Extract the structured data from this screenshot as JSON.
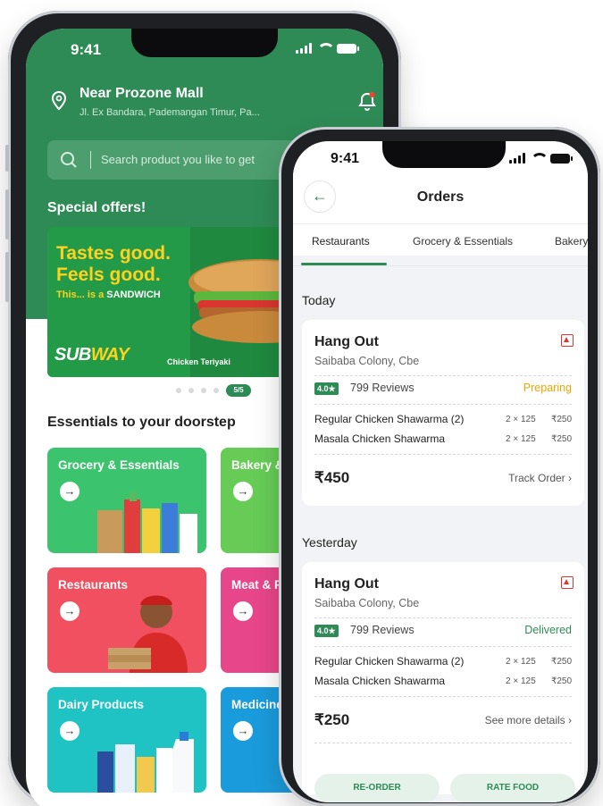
{
  "colors": {
    "brand_green": "#2e8b55",
    "preparing": "#f0a500",
    "delivered": "#2e8b55",
    "banner_yellow": "#ffd21f"
  },
  "phone1": {
    "status": {
      "time": "9:41"
    },
    "location": {
      "title": "Near Prozone Mall",
      "subtitle": "Jl. Ex Bandara, Pademangan Timur, Pa...",
      "icon": "location-pin-icon"
    },
    "notification_icon": "bell-icon",
    "search": {
      "placeholder": "Search product you like to get",
      "icon": "search-icon"
    },
    "offers": {
      "label": "Special offers!",
      "banner": {
        "headline": "Tastes good.\nFeels good.",
        "tagline_prefix": "This... is a ",
        "tagline_bold": "SANDWICH",
        "brand_a": "SUB",
        "brand_b": "WAY",
        "caption": "Chicken Teriyaki"
      },
      "pager": "5/5"
    },
    "essentials": {
      "title": "Essentials to your doorstep",
      "tiles": [
        {
          "label": "Grocery & Essentials",
          "color": "#3cc36e"
        },
        {
          "label": "Bakery &",
          "color": "#66cc56"
        },
        {
          "label": "Restaurants",
          "color": "#f0505f"
        },
        {
          "label": "Meat & F",
          "color": "#e8468a"
        },
        {
          "label": "Dairy Products",
          "color": "#20c3c4"
        },
        {
          "label": "Medicine",
          "color": "#1a9bdc"
        }
      ]
    }
  },
  "phone2": {
    "status": {
      "time": "9:41"
    },
    "title": "Orders",
    "tabs": [
      "Restaurants",
      "Grocery & Essentials",
      "Bakery"
    ],
    "sections": [
      {
        "label": "Today",
        "order": {
          "name": "Hang Out",
          "address": "Saibaba Colony, Cbe",
          "rating": "4.0★",
          "reviews": "799 Reviews",
          "status": "Preparing",
          "items": [
            {
              "name": "Regular Chicken Shawarma (2)",
              "qty": "2 × 125",
              "price": "₹250"
            },
            {
              "name": "Masala Chicken Shawarma",
              "qty": "2 × 125",
              "price": "₹250"
            }
          ],
          "total": "₹450",
          "link": "Track Order"
        }
      },
      {
        "label": "Yesterday",
        "order": {
          "name": "Hang Out",
          "address": "Saibaba Colony, Cbe",
          "rating": "4.0★",
          "reviews": "799 Reviews",
          "status": "Delivered",
          "items": [
            {
              "name": "Regular Chicken Shawarma (2)",
              "qty": "2 × 125",
              "price": "₹250"
            },
            {
              "name": "Masala Chicken Shawarma",
              "qty": "2 × 125",
              "price": "₹250"
            }
          ],
          "total": "₹250",
          "link": "See more details"
        }
      }
    ],
    "buttons": {
      "reorder": "RE-ORDER",
      "rate": "RATE FOOD"
    }
  }
}
